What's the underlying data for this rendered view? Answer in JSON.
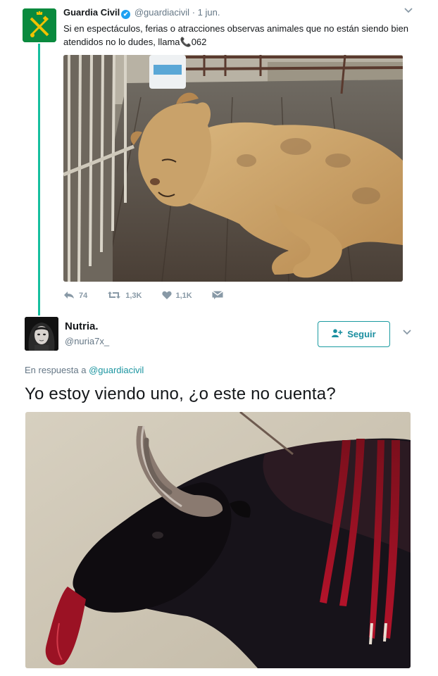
{
  "tweet1": {
    "author_name": "Guardia Civil",
    "verified_mark": "✔",
    "handle": "@guardiacivil",
    "separator": "·",
    "date": "1 jun.",
    "text_main": "Si en espectáculos, ferias o atracciones observas animales que no están siendo bien atendidos no lo dudes, llama",
    "phone_emoji": "📞",
    "phone_number": "062",
    "actions": {
      "reply_count": "74",
      "retweet_count": "1,3K",
      "like_count": "1,1K"
    },
    "icons": {
      "reply": "reply-icon",
      "retweet": "retweet-icon",
      "like": "heart-icon",
      "dm": "envelope-icon",
      "menu": "chevron-down-icon"
    }
  },
  "tweet2": {
    "author_name": "Nutria.",
    "handle": "@nuria7x_",
    "follow_label": "Seguir",
    "follow_icon": "add-user-icon",
    "reply_prefix": "En respuesta a",
    "reply_mention": "@guardiacivil",
    "text": "Yo estoy viendo uno, ¿o este no cuenta?"
  },
  "colors": {
    "accent": "#1b95a0",
    "thread_line": "#17bf9f",
    "muted": "#657786",
    "verified": "#1da1f2",
    "gc_green": "#0a8a3e",
    "gc_gold": "#f2c200"
  }
}
